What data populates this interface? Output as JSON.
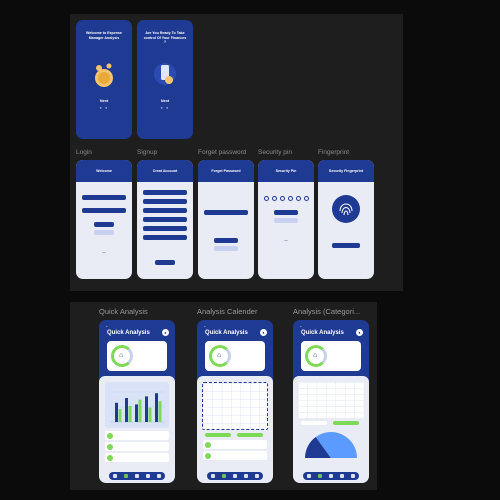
{
  "sections": {
    "onboarding": {
      "screens": [
        {
          "title": "Welcome to Expense Manager Analysis",
          "next": "Next",
          "dots": "● ●"
        },
        {
          "title": "Are You Ready To Take control Of Your Finances ?",
          "next": "Next",
          "dots": "● ●"
        }
      ]
    },
    "auth": {
      "screens": [
        {
          "label": "Login",
          "header": "Welcome"
        },
        {
          "label": "Signup",
          "header": "Creat Account"
        },
        {
          "label": "Forget password",
          "header": "Forget Password"
        },
        {
          "label": "Security pin",
          "header": "Security Pin"
        },
        {
          "label": "Fingerprint",
          "header": "Security Fingerprint"
        }
      ]
    },
    "analysis": {
      "screens": [
        {
          "label": "Quick Analysis",
          "title": "Quick Analysis"
        },
        {
          "label": "Analysis Calender",
          "title": "Quick Analysis"
        },
        {
          "label": "Analysis (Categori...",
          "title": "Quick Analysis"
        }
      ]
    }
  },
  "colors": {
    "brand": "#1f3a93",
    "accent": "#7ed957",
    "surface": "#e9ecf5"
  },
  "chart_data": [
    {
      "type": "bar",
      "title": "",
      "categories": [
        "",
        "",
        "",
        "",
        ""
      ],
      "series": [
        {
          "values": [
            60,
            75,
            55,
            80,
            90
          ]
        },
        {
          "values": [
            40,
            50,
            70,
            45,
            65
          ]
        }
      ],
      "ylim": [
        0,
        100
      ]
    },
    {
      "type": "pie",
      "slices": [
        {
          "label": "",
          "value": 30
        },
        {
          "label": "",
          "value": 70
        }
      ]
    }
  ]
}
